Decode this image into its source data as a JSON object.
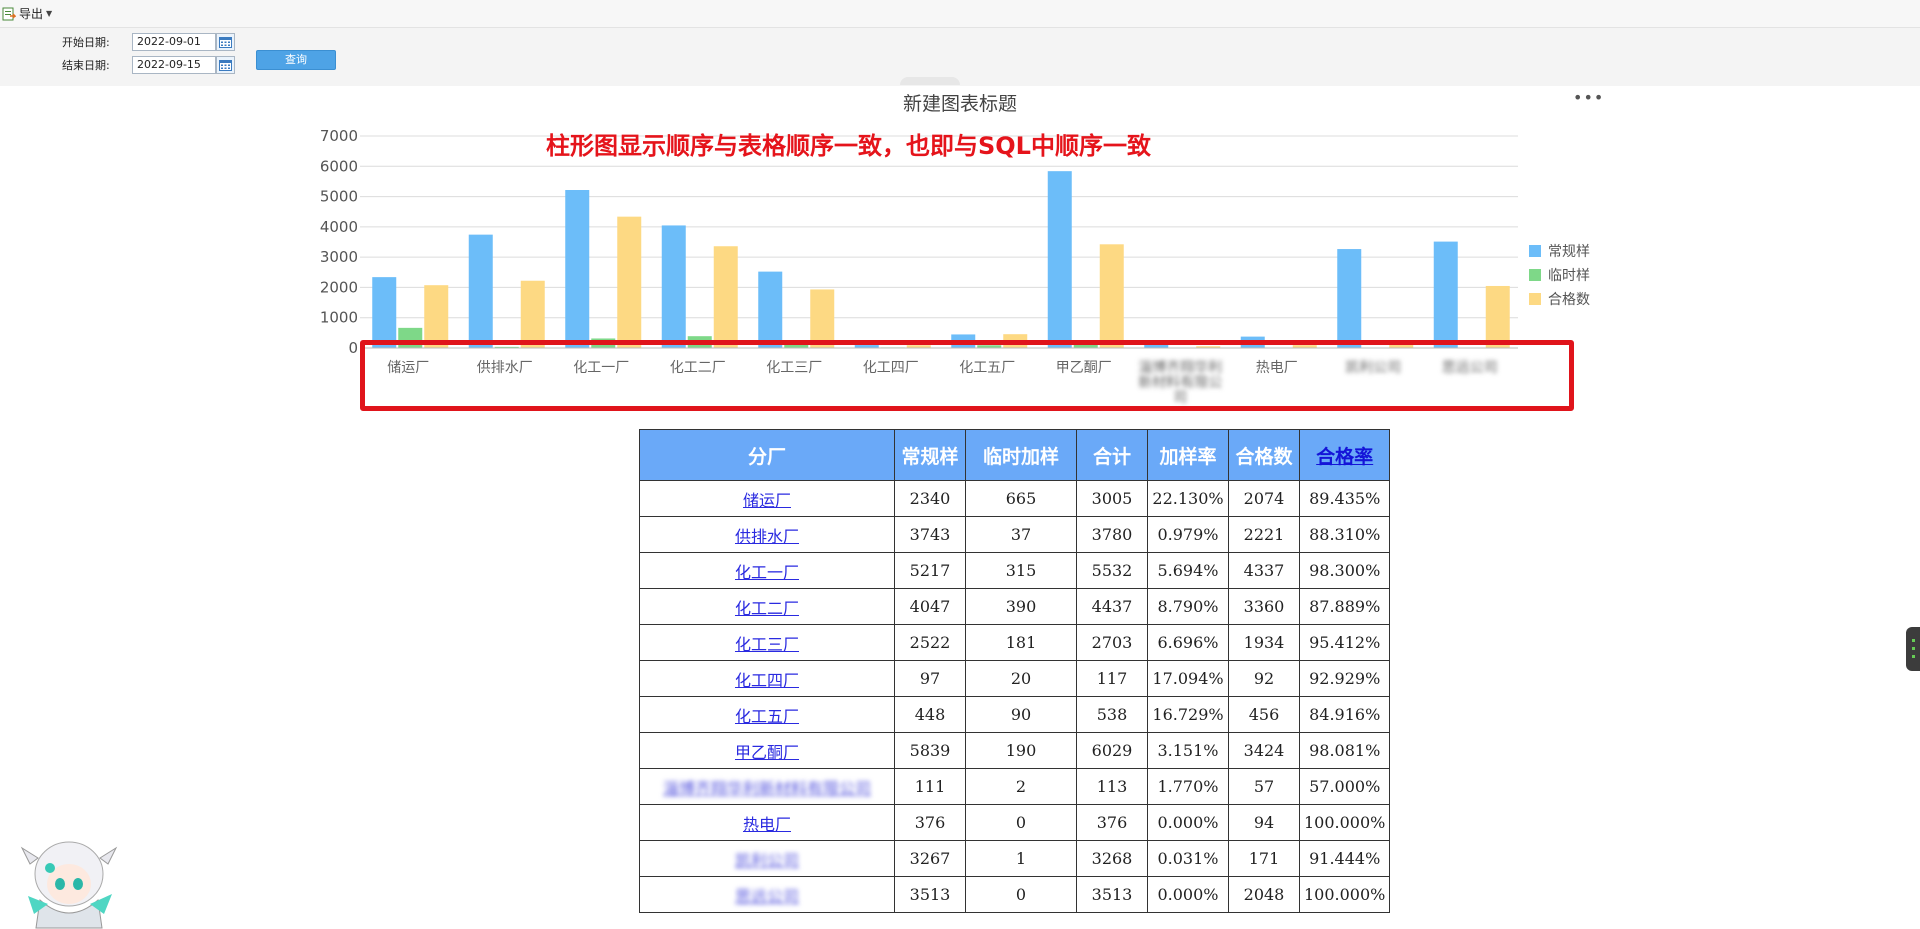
{
  "toolbar": {
    "export_label": "导出"
  },
  "filters": {
    "start_label": "开始日期:",
    "start_value": "2022-09-01",
    "end_label": "结束日期:",
    "end_value": "2022-09-15",
    "query_label": "查询"
  },
  "annotation": "柱形图显示顺序与表格顺序一致，也即与SQL中顺序一致",
  "chart_data": {
    "type": "bar",
    "title": "新建图表标题",
    "categories": [
      "储运厂",
      "供排水厂",
      "化工一厂",
      "化工二厂",
      "化工三厂",
      "化工四厂",
      "化工五厂",
      "甲乙酮厂",
      "淄博齐翔华利新材料有限公司",
      "热电厂",
      "凯利公司",
      "思远公司"
    ],
    "series": [
      {
        "name": "常规样",
        "color": "#6cbdf9",
        "values": [
          2340,
          3743,
          5217,
          4047,
          2522,
          97,
          448,
          5839,
          111,
          376,
          3267,
          3513
        ]
      },
      {
        "name": "临时样",
        "color": "#7ed888",
        "values": [
          665,
          37,
          315,
          390,
          181,
          20,
          90,
          190,
          2,
          0,
          1,
          0
        ]
      },
      {
        "name": "合格数",
        "color": "#fdd983",
        "values": [
          2074,
          2221,
          4337,
          3360,
          1934,
          92,
          456,
          3424,
          57,
          94,
          171,
          2048
        ]
      }
    ],
    "ylim": [
      0,
      7000
    ],
    "yticks": [
      0,
      1000,
      2000,
      3000,
      4000,
      5000,
      6000,
      7000
    ],
    "grid": true,
    "legend_position": "right"
  },
  "table": {
    "headers": [
      "分厂",
      "常规样",
      "临时加样",
      "合计",
      "加样率",
      "合格数",
      "合格率"
    ],
    "rows": [
      [
        "储运厂",
        "2340",
        "665",
        "3005",
        "22.130%",
        "2074",
        "89.435%"
      ],
      [
        "供排水厂",
        "3743",
        "37",
        "3780",
        "0.979%",
        "2221",
        "88.310%"
      ],
      [
        "化工一厂",
        "5217",
        "315",
        "5532",
        "5.694%",
        "4337",
        "98.300%"
      ],
      [
        "化工二厂",
        "4047",
        "390",
        "4437",
        "8.790%",
        "3360",
        "87.889%"
      ],
      [
        "化工三厂",
        "2522",
        "181",
        "2703",
        "6.696%",
        "1934",
        "95.412%"
      ],
      [
        "化工四厂",
        "97",
        "20",
        "117",
        "17.094%",
        "92",
        "92.929%"
      ],
      [
        "化工五厂",
        "448",
        "90",
        "538",
        "16.729%",
        "456",
        "84.916%"
      ],
      [
        "甲乙酮厂",
        "5839",
        "190",
        "6029",
        "3.151%",
        "3424",
        "98.081%"
      ],
      [
        "淄博齐翔华利新材料有限公司",
        "111",
        "2",
        "113",
        "1.770%",
        "57",
        "57.000%"
      ],
      [
        "热电厂",
        "376",
        "0",
        "376",
        "0.000%",
        "94",
        "100.000%"
      ],
      [
        "凯利公司",
        "3267",
        "1",
        "3268",
        "0.031%",
        "171",
        "91.444%"
      ],
      [
        "思远公司",
        "3513",
        "0",
        "3513",
        "0.000%",
        "2048",
        "100.000%"
      ]
    ]
  }
}
